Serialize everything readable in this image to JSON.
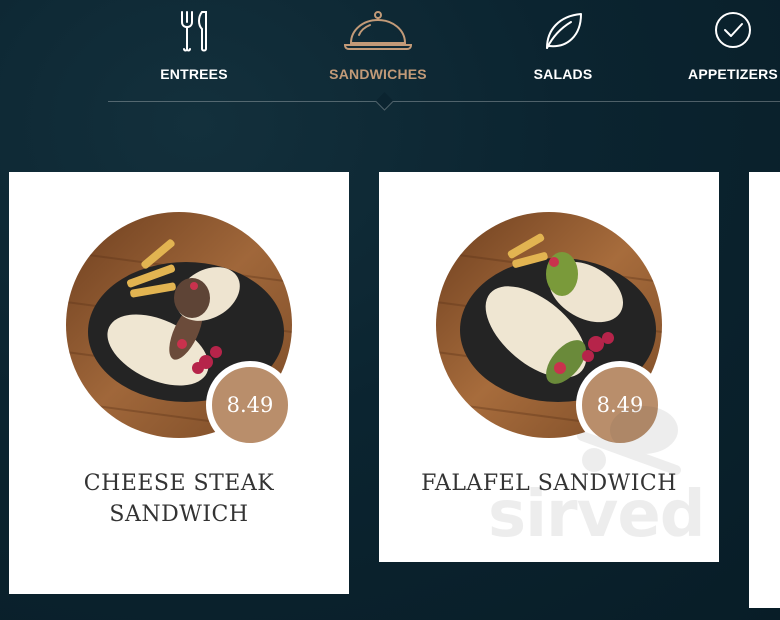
{
  "nav": {
    "active": "sandwiches",
    "items": [
      {
        "key": "entrees",
        "label": "ENTREES",
        "icon": "fork-knife-icon"
      },
      {
        "key": "sandwiches",
        "label": "SANDWICHES",
        "icon": "cloche-icon"
      },
      {
        "key": "salads",
        "label": "SALADS",
        "icon": "leaf-icon"
      },
      {
        "key": "appetizers",
        "label": "APPETIZERS",
        "icon": "check-circle-icon"
      }
    ]
  },
  "menu": {
    "items": [
      {
        "name_line1": "CHEESE STEAK",
        "name_line2": "SANDWICH",
        "price": "8.49"
      },
      {
        "name_line1": "FALAFEL SANDWICH",
        "name_line2": "",
        "price": "8.49"
      }
    ]
  },
  "watermark": {
    "text": "sirved"
  },
  "colors": {
    "background": "#0b2430",
    "accent": "#c29a78",
    "price_badge": "#b98e6b",
    "card": "#ffffff"
  }
}
